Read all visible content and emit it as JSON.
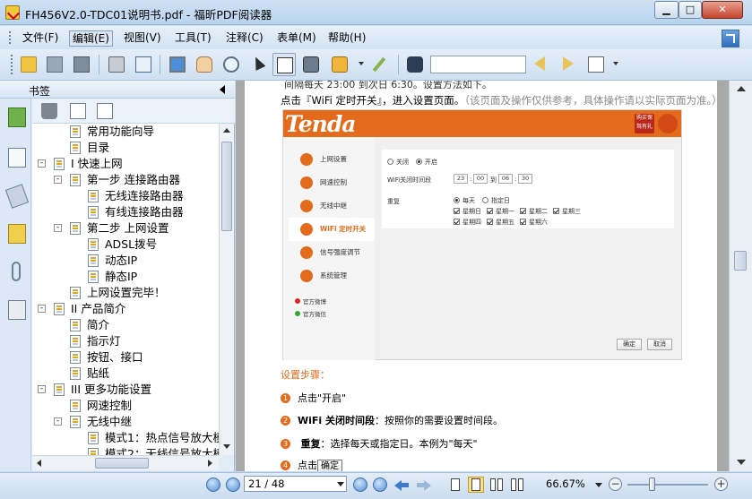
{
  "window": {
    "title": "FH456V2.0-TDC01说明书.pdf - 福昕PDF阅读器"
  },
  "menu": [
    {
      "label": "文件(F)",
      "active": false
    },
    {
      "label": "编辑(E)",
      "active": true
    },
    {
      "label": "视图(V)",
      "active": false
    },
    {
      "label": "工具(T)",
      "active": false
    },
    {
      "label": "注释(C)",
      "active": false
    },
    {
      "label": "表单(M)",
      "active": false
    },
    {
      "label": "帮助(H)",
      "active": false
    }
  ],
  "toolbar": {
    "search_placeholder": ""
  },
  "bookmarks": {
    "title": "书签",
    "items": [
      {
        "label": "常用功能向导",
        "level": 1,
        "expander": "none"
      },
      {
        "label": "目录",
        "level": 1,
        "expander": "none"
      },
      {
        "label": "I 快速上网",
        "level": 0,
        "expander": "-"
      },
      {
        "label": "第一步  连接路由器",
        "level": 1,
        "expander": "-"
      },
      {
        "label": "无线连接路由器",
        "level": 2,
        "expander": "none"
      },
      {
        "label": "有线连接路由器",
        "level": 2,
        "expander": "none"
      },
      {
        "label": "第二步  上网设置",
        "level": 1,
        "expander": "-"
      },
      {
        "label": "ADSL拨号",
        "level": 2,
        "expander": "none"
      },
      {
        "label": "动态IP",
        "level": 2,
        "expander": "none"
      },
      {
        "label": "静态IP",
        "level": 2,
        "expander": "none"
      },
      {
        "label": "上网设置完毕！",
        "level": 1,
        "expander": "none"
      },
      {
        "label": "II 产品简介",
        "level": 0,
        "expander": "-"
      },
      {
        "label": "简介",
        "level": 1,
        "expander": "none"
      },
      {
        "label": "指示灯",
        "level": 1,
        "expander": "none"
      },
      {
        "label": "按钮、接口",
        "level": 1,
        "expander": "none"
      },
      {
        "label": "贴纸",
        "level": 1,
        "expander": "none"
      },
      {
        "label": "III 更多功能设置",
        "level": 0,
        "expander": "-"
      },
      {
        "label": "网速控制",
        "level": 1,
        "expander": "none"
      },
      {
        "label": "无线中继",
        "level": 1,
        "expander": "-"
      },
      {
        "label": "模式1：热点信号放大模",
        "level": 2,
        "expander": "none"
      },
      {
        "label": "模式2：无线信号放大模",
        "level": 2,
        "expander": "none"
      }
    ]
  },
  "document": {
    "top_line": "间隔每天 23:00 到次日 6:30。设置方法如下。",
    "heading_main": "点击『WiFi 定时开关』，进入设置页面。",
    "heading_note": "（该页面及操作仅供参考，具体操作请以实际页面为准。）",
    "screenshot": {
      "logo": "Tenda",
      "badge": "购买保驾有礼",
      "nav": [
        {
          "label": "上网设置",
          "active": false
        },
        {
          "label": "网速控制",
          "active": false
        },
        {
          "label": "无线中继",
          "active": false
        },
        {
          "label": "WiFi 定时开关",
          "active": true
        },
        {
          "label": "信号强度调节",
          "active": false
        },
        {
          "label": "系统管理",
          "active": false
        }
      ],
      "weibo": "官方微博",
      "wechat": "官方微信",
      "radio_off": "关闭",
      "radio_on": "开启",
      "time_label": "WiFi关闭时间段",
      "time": [
        "23",
        "00",
        "06",
        "30"
      ],
      "time_sep_to": "到",
      "repeat_label": "重复",
      "repeat_daily": "每天",
      "repeat_custom": "指定日",
      "days": [
        "星期日",
        "星期一",
        "星期二",
        "星期三",
        "星期四",
        "星期五",
        "星期六"
      ],
      "ok": "确定",
      "cancel": "取消"
    },
    "steps_title": "设置步骤：",
    "steps": [
      {
        "num": "1",
        "bold": "",
        "text": "点击\"开启\""
      },
      {
        "num": "2",
        "bold": "WiFi 关闭时间段",
        "text": "：按照你的需要设置时间段。"
      },
      {
        "num": "3",
        "bold": "重复",
        "text": "：选择每天或指定日。本例为\"每天\""
      },
      {
        "num": "4",
        "bold": "",
        "text": "点击"
      }
    ],
    "confirm_tip": "确定"
  },
  "statusbar": {
    "page": "21 / 48",
    "zoom": "66.67%"
  }
}
